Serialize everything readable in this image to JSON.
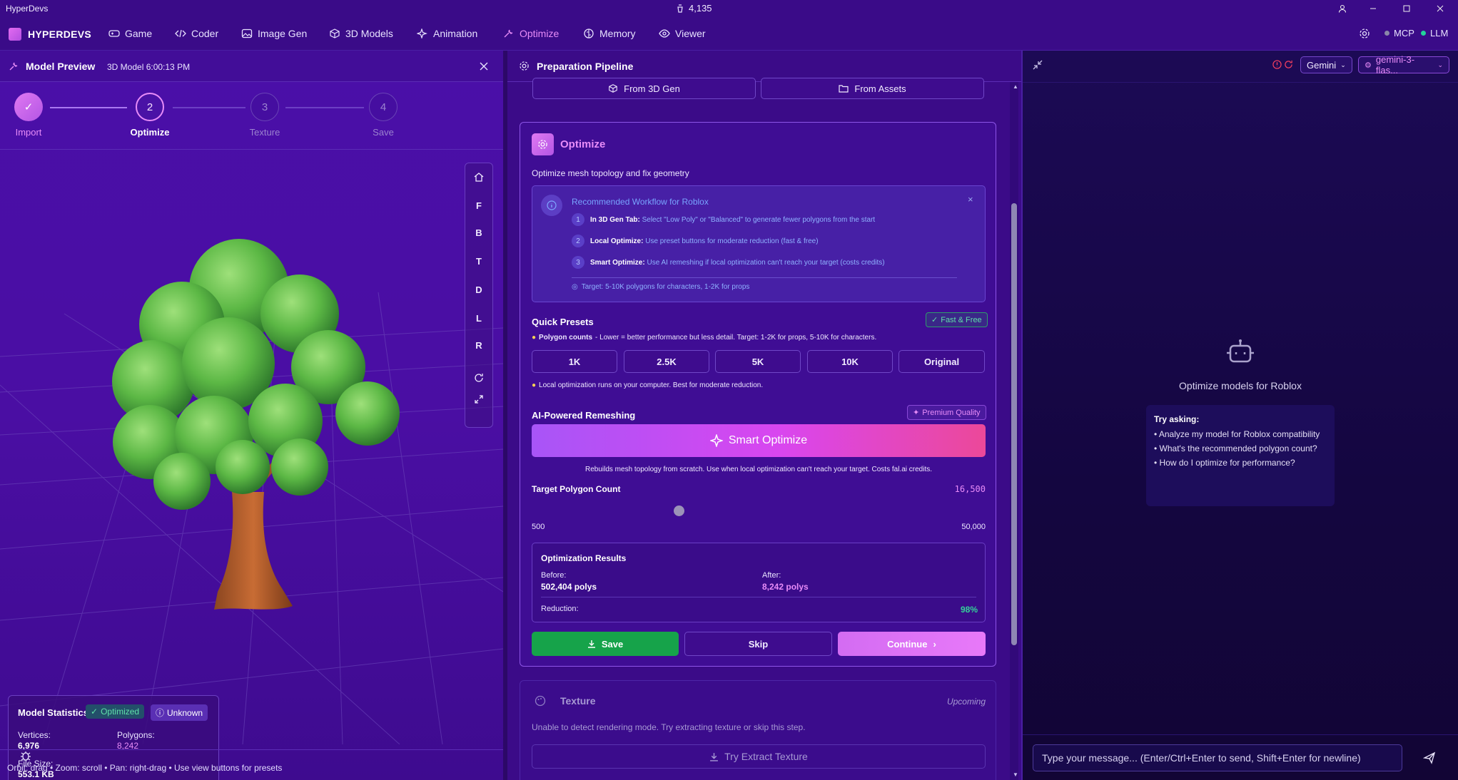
{
  "app_title": "HyperDevs",
  "credits": "4,135",
  "nav": {
    "brand": "HYPERDEVS",
    "tabs": [
      {
        "label": "Game",
        "icon": "gamepad-icon"
      },
      {
        "label": "Coder",
        "icon": "code-icon"
      },
      {
        "label": "Image Gen",
        "icon": "image-icon"
      },
      {
        "label": "3D Models",
        "icon": "cube-icon"
      },
      {
        "label": "Animation",
        "icon": "sparkle-icon"
      },
      {
        "label": "Optimize",
        "icon": "wrench-icon",
        "active": true
      },
      {
        "label": "Memory",
        "icon": "brain-icon"
      },
      {
        "label": "Viewer",
        "icon": "eye-icon"
      }
    ],
    "mcp": "MCP",
    "llm": "LLM",
    "mcp_color": "#8a86a8",
    "llm_color": "#22d39a"
  },
  "preview": {
    "title": "Model Preview",
    "subtitle": "3D Model 6:00:13 PM",
    "steps": [
      {
        "num": "✓",
        "label": "Import"
      },
      {
        "num": "2",
        "label": "Optimize"
      },
      {
        "num": "3",
        "label": "Texture"
      },
      {
        "num": "4",
        "label": "Save"
      }
    ],
    "view_buttons": [
      "F",
      "B",
      "T",
      "D",
      "L",
      "R"
    ],
    "hint": "Orbit: drag • Zoom: scroll • Pan: right-drag • Use view buttons for presets",
    "stats": {
      "title": "Model Statistics",
      "badge_optimized": "Optimized",
      "badge_unknown": "Unknown",
      "vertices_label": "Vertices:",
      "vertices": "6,976",
      "polygons_label": "Polygons:",
      "polygons": "8,242",
      "filesize_label": "File Size:",
      "filesize": "553.1 KB"
    }
  },
  "pipeline": {
    "title": "Preparation Pipeline",
    "from_3d": "From 3D Gen",
    "from_assets": "From Assets",
    "optimize_title": "Optimize",
    "optimize_desc": "Optimize mesh topology and fix geometry",
    "workflow": {
      "title": "Recommended Workflow for Roblox",
      "items": [
        {
          "n": "1",
          "bold": "In 3D Gen Tab:",
          "text": " Select \"Low Poly\" or \"Balanced\" to generate fewer polygons from the start"
        },
        {
          "n": "2",
          "bold": "Local Optimize:",
          "text": " Use preset buttons for moderate reduction (fast & free)"
        },
        {
          "n": "3",
          "bold": "Smart Optimize:",
          "text": " Use AI remeshing if local optimization can't reach your target (costs credits)"
        }
      ],
      "target": "Target: 5-10K polygons for characters, 1-2K for props"
    },
    "quick_presets": "Quick Presets",
    "fast_free": "Fast & Free",
    "poly_tip_bold": "Polygon counts",
    "poly_tip": " - Lower = better performance but less detail. Target: 1-2K for props, 5-10K for characters.",
    "presets": [
      "1K",
      "2.5K",
      "5K",
      "10K",
      "Original"
    ],
    "local_tip": "Local optimization runs on your computer. Best for moderate reduction.",
    "ai_title": "AI-Powered Remeshing",
    "premium": "Premium Quality",
    "smart_optimize": "Smart Optimize",
    "smart_desc": "Rebuilds mesh topology from scratch. Use when local optimization can't reach your target. Costs fal.ai credits.",
    "target_label": "Target Polygon Count",
    "target_value": "16,500",
    "slider_min": "500",
    "slider_max": "50,000",
    "slider_fraction": 0.324,
    "results": {
      "title": "Optimization Results",
      "before_label": "Before:",
      "before": "502,404 polys",
      "after_label": "After:",
      "after": "8,242 polys",
      "reduction_label": "Reduction:",
      "reduction": "98%"
    },
    "save": "Save",
    "skip": "Skip",
    "continue": "Continue",
    "texture_title": "Texture",
    "texture_status": "Upcoming",
    "texture_desc": "Unable to detect rendering mode. Try extracting texture or skip this step.",
    "extract": "Try Extract Texture"
  },
  "chat": {
    "provider": "Gemini",
    "model": "gemini-3-flas...",
    "empty_title": "Optimize models for Roblox",
    "try_title": "Try asking:",
    "suggestions": [
      "Analyze my model for Roblox compatibility",
      "What's the recommended polygon count?",
      "How do I optimize for performance?"
    ],
    "placeholder": "Type your message... (Enter/Ctrl+Enter to send, Shift+Enter for newline)"
  }
}
